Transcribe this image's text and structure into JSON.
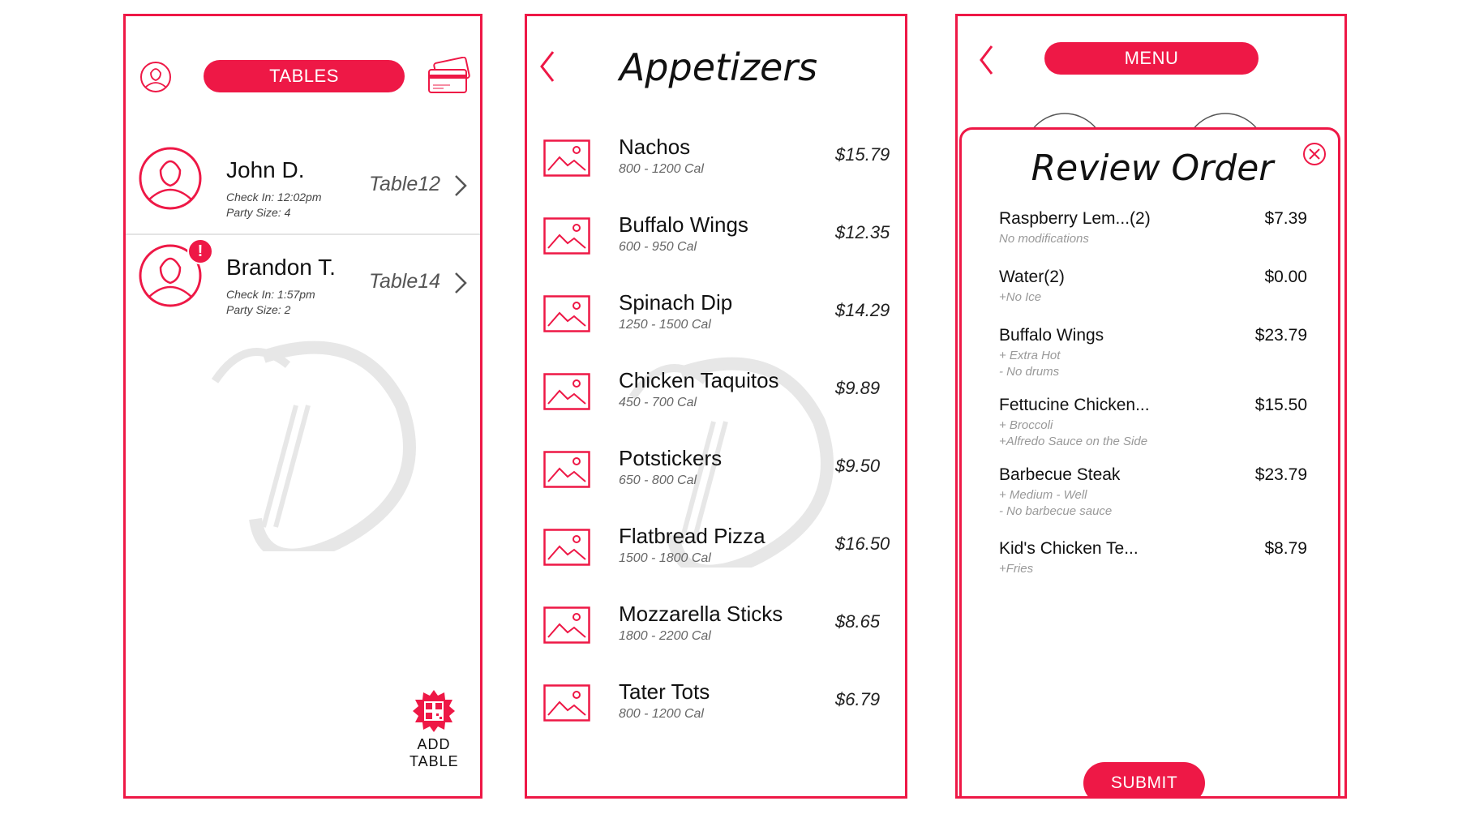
{
  "colors": {
    "accent": "#ee1846",
    "text": "#111111",
    "muted": "#999999"
  },
  "tables_screen": {
    "header_label": "TABLES",
    "tables": [
      {
        "name": "John D.",
        "check_in": "Check In: 12:02pm",
        "party_size": "Party Size: 4",
        "table": "Table12",
        "alert": ""
      },
      {
        "name": "Brandon T.",
        "check_in": "Check In: 1:57pm",
        "party_size": "Party Size: 2",
        "table": "Table14",
        "alert": "!"
      }
    ],
    "add_table": {
      "line1": "ADD",
      "line2": "TABLE"
    }
  },
  "appetizers_screen": {
    "title": "Appetizers",
    "items": [
      {
        "name": "Nachos",
        "calories": "800 - 1200 Cal",
        "price": "$15.79"
      },
      {
        "name": "Buffalo Wings",
        "calories": "600 - 950 Cal",
        "price": "$12.35"
      },
      {
        "name": "Spinach Dip",
        "calories": "1250 - 1500 Cal",
        "price": "$14.29"
      },
      {
        "name": "Chicken Taquitos",
        "calories": "450 - 700 Cal",
        "price": "$9.89"
      },
      {
        "name": "Potstickers",
        "calories": "650 - 800 Cal",
        "price": "$9.50"
      },
      {
        "name": "Flatbread Pizza",
        "calories": "1500 - 1800 Cal",
        "price": "$16.50"
      },
      {
        "name": "Mozzarella Sticks",
        "calories": "1800 - 2200 Cal",
        "price": "$8.65"
      },
      {
        "name": "Tater Tots",
        "calories": "800 - 1200 Cal",
        "price": "$6.79"
      }
    ]
  },
  "review_screen": {
    "menu_label": "MENU",
    "title": "Review Order",
    "items": [
      {
        "name": "Raspberry Lem...(2)",
        "price": "$7.39",
        "mods": [
          "No modifications"
        ]
      },
      {
        "name": "Water(2)",
        "price": "$0.00",
        "mods": [
          "+No Ice"
        ]
      },
      {
        "name": "Buffalo Wings",
        "price": "$23.79",
        "mods": [
          "+ Extra Hot",
          "- No drums"
        ]
      },
      {
        "name": "Fettucine Chicken...",
        "price": "$15.50",
        "mods": [
          "+ Broccoli",
          "+Alfredo Sauce on the Side"
        ]
      },
      {
        "name": "Barbecue Steak",
        "price": "$23.79",
        "mods": [
          "+ Medium - Well",
          "- No barbecue sauce"
        ]
      },
      {
        "name": "Kid's Chicken Te...",
        "price": "$8.79",
        "mods": [
          "+Fries"
        ]
      }
    ],
    "submit_label": "SUBMIT"
  }
}
